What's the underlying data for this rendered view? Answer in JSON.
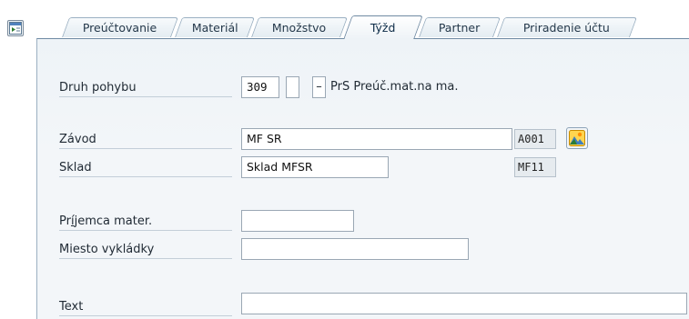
{
  "tabs": [
    {
      "label": "Preúčtovanie",
      "active": false
    },
    {
      "label": "Materiál",
      "active": false
    },
    {
      "label": "Množstvo",
      "active": false
    },
    {
      "label": "Týžd",
      "active": true
    },
    {
      "label": "Partner",
      "active": false
    },
    {
      "label": "Priradenie účtu",
      "active": false
    }
  ],
  "form": {
    "movement_type": {
      "label": "Druh pohybu",
      "value": "309",
      "dash": "–",
      "description": "PrS Preúč.mat.na ma."
    },
    "plant": {
      "label": "Závod",
      "value": "MF SR",
      "code": "A001"
    },
    "storage": {
      "label": "Sklad",
      "value": "Sklad MFSR",
      "code": "MF11"
    },
    "recipient": {
      "label_pre": "Pr",
      "label_ul": "í",
      "label_post": "jemca mater.",
      "value": ""
    },
    "unloading_point": {
      "label": "Miesto vykládky",
      "value": ""
    },
    "text": {
      "label": "Text",
      "value": ""
    }
  },
  "icons": {
    "toolbar": "layout-toggle-icon",
    "plant_picture": "landscape-picture-icon"
  }
}
